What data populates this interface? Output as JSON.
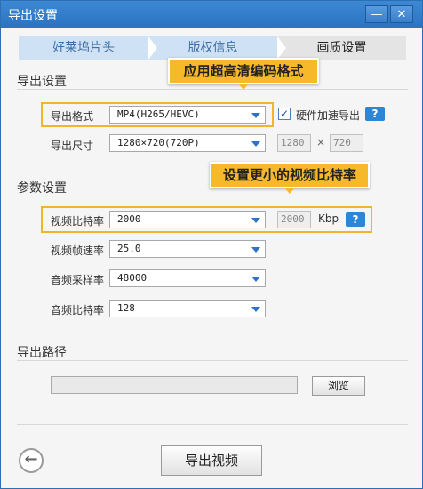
{
  "window": {
    "title": "导出设置",
    "minimize_glyph": "—",
    "close_glyph": "✕"
  },
  "tabs": [
    {
      "label": "好莱坞片头",
      "active": false
    },
    {
      "label": "版权信息",
      "active": false
    },
    {
      "label": "画质设置",
      "active": true
    }
  ],
  "export_settings": {
    "section_title": "导出设置",
    "callout": "应用超高清编码格式",
    "format_label": "导出格式",
    "format_value": "MP4(H265/HEVC)",
    "hw_accel_checked": true,
    "hw_accel_label": "硬件加速导出",
    "help_glyph": "?",
    "size_label": "导出尺寸",
    "size_value": "1280×720(720P)",
    "width_value": "1280",
    "times": "×",
    "height_value": "720"
  },
  "param_settings": {
    "section_title": "参数设置",
    "callout": "设置更小的视频比特率",
    "bitrate_label": "视频比特率",
    "bitrate_value": "2000",
    "bitrate_custom": "2000",
    "bitrate_unit": "Kbp",
    "help_glyph": "?",
    "framerate_label": "视频帧速率",
    "framerate_value": "25.0",
    "samplerate_label": "音频采样率",
    "samplerate_value": "48000",
    "audio_bitrate_label": "音频比特率",
    "audio_bitrate_value": "128"
  },
  "export_path": {
    "section_title": "导出路径",
    "path_value": "",
    "browse_label": "浏览"
  },
  "footer": {
    "back_glyph": "←",
    "export_label": "导出视频"
  },
  "colors": {
    "titlebar": "#2b73c0",
    "highlight": "#f0b52a",
    "callout": "#f6b92a",
    "help": "#2b86d8"
  }
}
